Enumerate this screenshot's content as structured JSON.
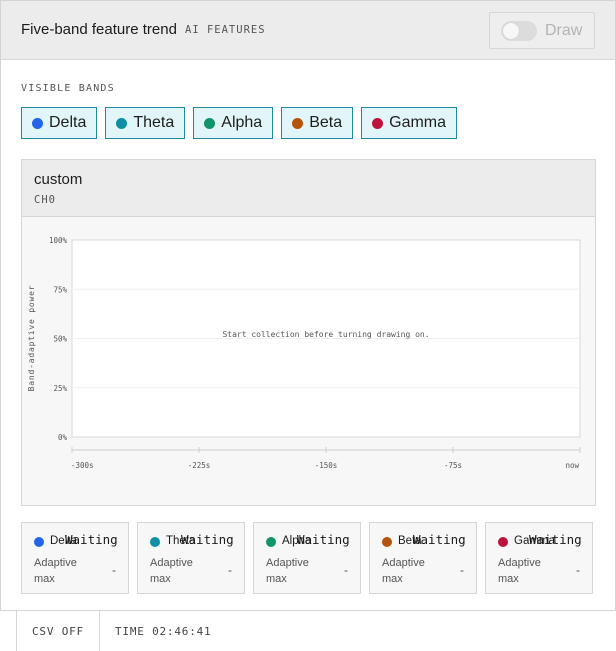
{
  "header": {
    "title": "Five-band feature trend",
    "tag": "AI FEATURES",
    "draw_label": "Draw",
    "draw_enabled": false
  },
  "bands_section": {
    "label": "VISIBLE BANDS",
    "bands": [
      {
        "label": "Delta",
        "color": "#2563eb"
      },
      {
        "label": "Theta",
        "color": "#0e8fa6"
      },
      {
        "label": "Alpha",
        "color": "#10956b"
      },
      {
        "label": "Beta",
        "color": "#b45309"
      },
      {
        "label": "Gamma",
        "color": "#be123c"
      }
    ]
  },
  "chart_card": {
    "title": "custom",
    "subtitle": "CH0"
  },
  "chart_data": {
    "type": "line",
    "title": "",
    "ylabel": "Band-adaptive power",
    "xlabel": "",
    "y_ticks": [
      "100%",
      "75%",
      "50%",
      "25%",
      "0%"
    ],
    "x_ticks": [
      "-300s",
      "-225s",
      "-150s",
      "-75s",
      "now"
    ],
    "ylim": [
      0,
      100
    ],
    "xlim": [
      -300,
      0
    ],
    "series": [],
    "empty_message": "Start collection before turning drawing on."
  },
  "stats": [
    {
      "band": "Delta",
      "color": "#2563eb",
      "state": "Waiting",
      "caption": "Adaptive max",
      "value": "-"
    },
    {
      "band": "Theta",
      "color": "#0e8fa6",
      "state": "Waiting",
      "caption": "Adaptive max",
      "value": "-"
    },
    {
      "band": "Alpha",
      "color": "#10956b",
      "state": "Waiting",
      "caption": "Adaptive max",
      "value": "-"
    },
    {
      "band": "Beta",
      "color": "#b45309",
      "state": "Waiting",
      "caption": "Adaptive max",
      "value": "-"
    },
    {
      "band": "Gamma",
      "color": "#be123c",
      "state": "Waiting",
      "caption": "Adaptive max",
      "value": "-"
    }
  ],
  "footer": {
    "csv": "CSV OFF",
    "time": "TIME 02:46:41"
  }
}
